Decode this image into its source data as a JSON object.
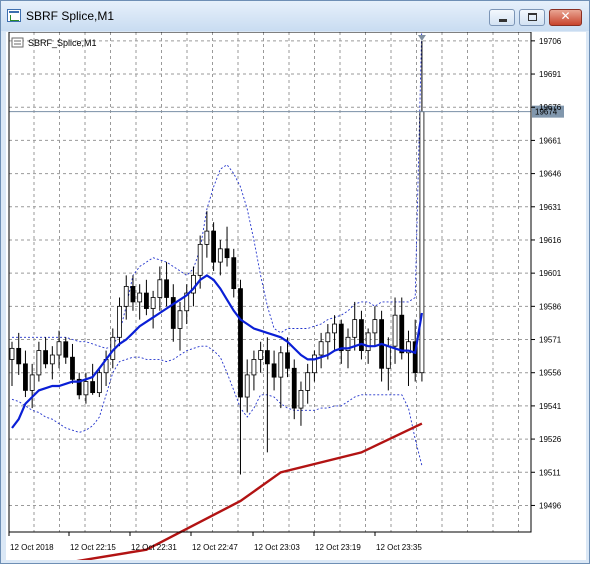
{
  "window": {
    "title": "SBRF Splice,M1"
  },
  "chart_data": {
    "type": "candlestick",
    "symbol_label": "SBRF_Splice,M1",
    "y_ticks": [
      19706,
      19691,
      19676,
      19661,
      19646,
      19631,
      19616,
      19601,
      19586,
      19571,
      19556,
      19541,
      19526,
      19511,
      19496
    ],
    "x_ticks": [
      "12 Oct 2018",
      "12 Oct 22:15",
      "12 Oct 22:31",
      "12 Oct 22:47",
      "12 Oct 23:03",
      "12 Oct 23:19",
      "12 Oct 23:35"
    ],
    "current_price": 19674,
    "ylim": [
      19484,
      19710
    ],
    "grid": true,
    "colors": {
      "bull": "#ffffff",
      "bear": "#000000",
      "ma_fast": "#0a1fd6",
      "ma_slow": "#b21313",
      "bands": "#2233cc",
      "grid": "#9a9a9a",
      "price_line": "#7a8fa6",
      "price_tag": "#8197ad"
    },
    "candles": [
      [
        19562,
        19570,
        19550,
        19567
      ],
      [
        19567,
        19574,
        19555,
        19560
      ],
      [
        19560,
        19566,
        19545,
        19548
      ],
      [
        19548,
        19560,
        19540,
        19555
      ],
      [
        19555,
        19570,
        19552,
        19566
      ],
      [
        19566,
        19572,
        19558,
        19560
      ],
      [
        19560,
        19568,
        19553,
        19564
      ],
      [
        19564,
        19575,
        19558,
        19570
      ],
      [
        19570,
        19572,
        19560,
        19563
      ],
      [
        19563,
        19569,
        19551,
        19553
      ],
      [
        19553,
        19556,
        19544,
        19546
      ],
      [
        19546,
        19556,
        19542,
        19552
      ],
      [
        19552,
        19560,
        19546,
        19547
      ],
      [
        19547,
        19558,
        19545,
        19556
      ],
      [
        19556,
        19566,
        19550,
        19562
      ],
      [
        19562,
        19576,
        19558,
        19572
      ],
      [
        19572,
        19590,
        19568,
        19586
      ],
      [
        19586,
        19600,
        19580,
        19595
      ],
      [
        19595,
        19600,
        19584,
        19588
      ],
      [
        19588,
        19596,
        19580,
        19592
      ],
      [
        19592,
        19598,
        19582,
        19585
      ],
      [
        19585,
        19593,
        19576,
        19590
      ],
      [
        19590,
        19604,
        19584,
        19598
      ],
      [
        19598,
        19606,
        19586,
        19590
      ],
      [
        19590,
        19596,
        19570,
        19576
      ],
      [
        19576,
        19588,
        19566,
        19584
      ],
      [
        19584,
        19596,
        19578,
        19592
      ],
      [
        19592,
        19604,
        19586,
        19600
      ],
      [
        19600,
        19618,
        19594,
        19614
      ],
      [
        19614,
        19629,
        19608,
        19620
      ],
      [
        19620,
        19624,
        19602,
        19606
      ],
      [
        19606,
        19616,
        19600,
        19612
      ],
      [
        19612,
        19622,
        19604,
        19608
      ],
      [
        19608,
        19612,
        19590,
        19594
      ],
      [
        19594,
        19598,
        19510,
        19545
      ],
      [
        19545,
        19562,
        19538,
        19555
      ],
      [
        19555,
        19566,
        19548,
        19562
      ],
      [
        19562,
        19570,
        19556,
        19566
      ],
      [
        19566,
        19572,
        19520,
        19560
      ],
      [
        19560,
        19566,
        19548,
        19554
      ],
      [
        19554,
        19568,
        19540,
        19565
      ],
      [
        19565,
        19572,
        19554,
        19558
      ],
      [
        19558,
        19562,
        19535,
        19540
      ],
      [
        19540,
        19552,
        19532,
        19548
      ],
      [
        19548,
        19560,
        19542,
        19556
      ],
      [
        19556,
        19566,
        19552,
        19564
      ],
      [
        19564,
        19574,
        19558,
        19570
      ],
      [
        19570,
        19578,
        19562,
        19574
      ],
      [
        19574,
        19582,
        19566,
        19578
      ],
      [
        19578,
        19580,
        19560,
        19566
      ],
      [
        19566,
        19576,
        19558,
        19572
      ],
      [
        19572,
        19588,
        19566,
        19580
      ],
      [
        19580,
        19584,
        19562,
        19566
      ],
      [
        19566,
        19576,
        19560,
        19574
      ],
      [
        19574,
        19586,
        19568,
        19580
      ],
      [
        19580,
        19584,
        19552,
        19558
      ],
      [
        19558,
        19572,
        19548,
        19568
      ],
      [
        19568,
        19590,
        19560,
        19582
      ],
      [
        19582,
        19590,
        19562,
        19565
      ],
      [
        19565,
        19575,
        19550,
        19570
      ],
      [
        19570,
        19580,
        19552,
        19556
      ],
      [
        19556,
        19706,
        19552,
        19674
      ]
    ],
    "ma_fast": [
      19531,
      19535,
      19542,
      19545,
      19548,
      19549,
      19550,
      19550,
      19551,
      19552,
      19552,
      19553,
      19554,
      19558,
      19562,
      19566,
      19569,
      19571,
      19574,
      19577,
      19579,
      19581,
      19583,
      19585,
      19587,
      19589,
      19591,
      19594,
      19598,
      19600,
      19598,
      19594,
      19589,
      19584,
      19580,
      19578,
      19576,
      19575,
      19574,
      19573,
      19572,
      19570,
      19567,
      19564,
      19562,
      19562,
      19563,
      19564,
      19566,
      19567,
      19567,
      19568,
      19569,
      19568,
      19568,
      19569,
      19568,
      19567,
      19566,
      19566,
      19565,
      19583
    ],
    "band_upper": [
      19572,
      19572,
      19572,
      19572,
      19572,
      19572,
      19572,
      19572,
      19572,
      19571,
      19570,
      19570,
      19569,
      19568,
      19567,
      19568,
      19574,
      19586,
      19600,
      19604,
      19606,
      19608,
      19607,
      19606,
      19604,
      19602,
      19600,
      19603,
      19612,
      19630,
      19640,
      19648,
      19650,
      19646,
      19640,
      19630,
      19616,
      19600,
      19586,
      19576,
      19574,
      19576,
      19576,
      19576,
      19576,
      19577,
      19578,
      19580,
      19581,
      19582,
      19584,
      19587,
      19588,
      19588,
      19586,
      19588,
      19588,
      19588,
      19588,
      19588,
      19590,
      19714
    ],
    "band_lower": [
      19544,
      19543,
      19541,
      19539,
      19538,
      19536,
      19535,
      19533,
      19531,
      19530,
      19529,
      19530,
      19532,
      19536,
      19546,
      19556,
      19561,
      19562,
      19563,
      19563,
      19562,
      19562,
      19562,
      19561,
      19562,
      19564,
      19566,
      19567,
      19568,
      19568,
      19566,
      19563,
      19556,
      19548,
      19540,
      19536,
      19540,
      19546,
      19546,
      19545,
      19542,
      19540,
      19539,
      19539,
      19539,
      19539,
      19540,
      19540,
      19541,
      19541,
      19543,
      19545,
      19546,
      19546,
      19546,
      19546,
      19546,
      19546,
      19546,
      19540,
      19526,
      19514
    ],
    "ma_slow": [
      [
        0,
        19466
      ],
      [
        20,
        19476
      ],
      [
        34,
        19498
      ],
      [
        40,
        19511
      ],
      [
        52,
        19520
      ],
      [
        61,
        19533
      ]
    ]
  }
}
